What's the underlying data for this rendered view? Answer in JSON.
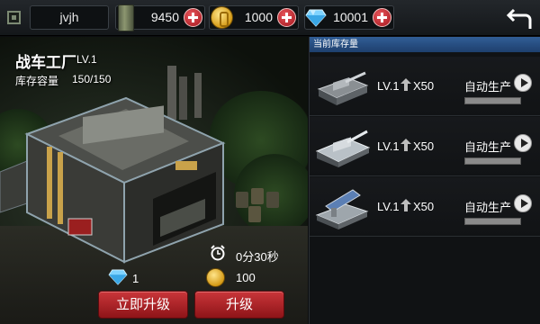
{
  "topbar": {
    "player_name": "jvjh",
    "resources": [
      {
        "name": "ammo",
        "icon": "ammo-crate-icon",
        "value": "9450"
      },
      {
        "name": "gold",
        "icon": "gold-coin-icon",
        "value": "1000"
      },
      {
        "name": "diamond",
        "icon": "diamond-icon",
        "value": "10001"
      }
    ]
  },
  "factory": {
    "title": "战车工厂",
    "level": "LV.1",
    "capacity_label": "库存容量",
    "capacity_value": "150/150",
    "timer": "0分30秒",
    "cost_gems": "1",
    "cost_gold": "100",
    "instant_button": "立即升级",
    "upgrade_button": "升级"
  },
  "panel": {
    "header": "当前库存量",
    "rows": [
      {
        "unit": "tank",
        "level": "LV.1",
        "count": "X50",
        "action": "自动生产",
        "progress": 0
      },
      {
        "unit": "heavy-tank",
        "level": "LV.1",
        "count": "X50",
        "action": "自动生产",
        "progress": 0
      },
      {
        "unit": "rocket-launcher",
        "level": "LV.1",
        "count": "X50",
        "action": "自动生产",
        "progress": 0
      }
    ]
  },
  "colors": {
    "accent_red": "#a3161d",
    "panel_header_blue": "#315e96",
    "gold": "#d49a16"
  }
}
